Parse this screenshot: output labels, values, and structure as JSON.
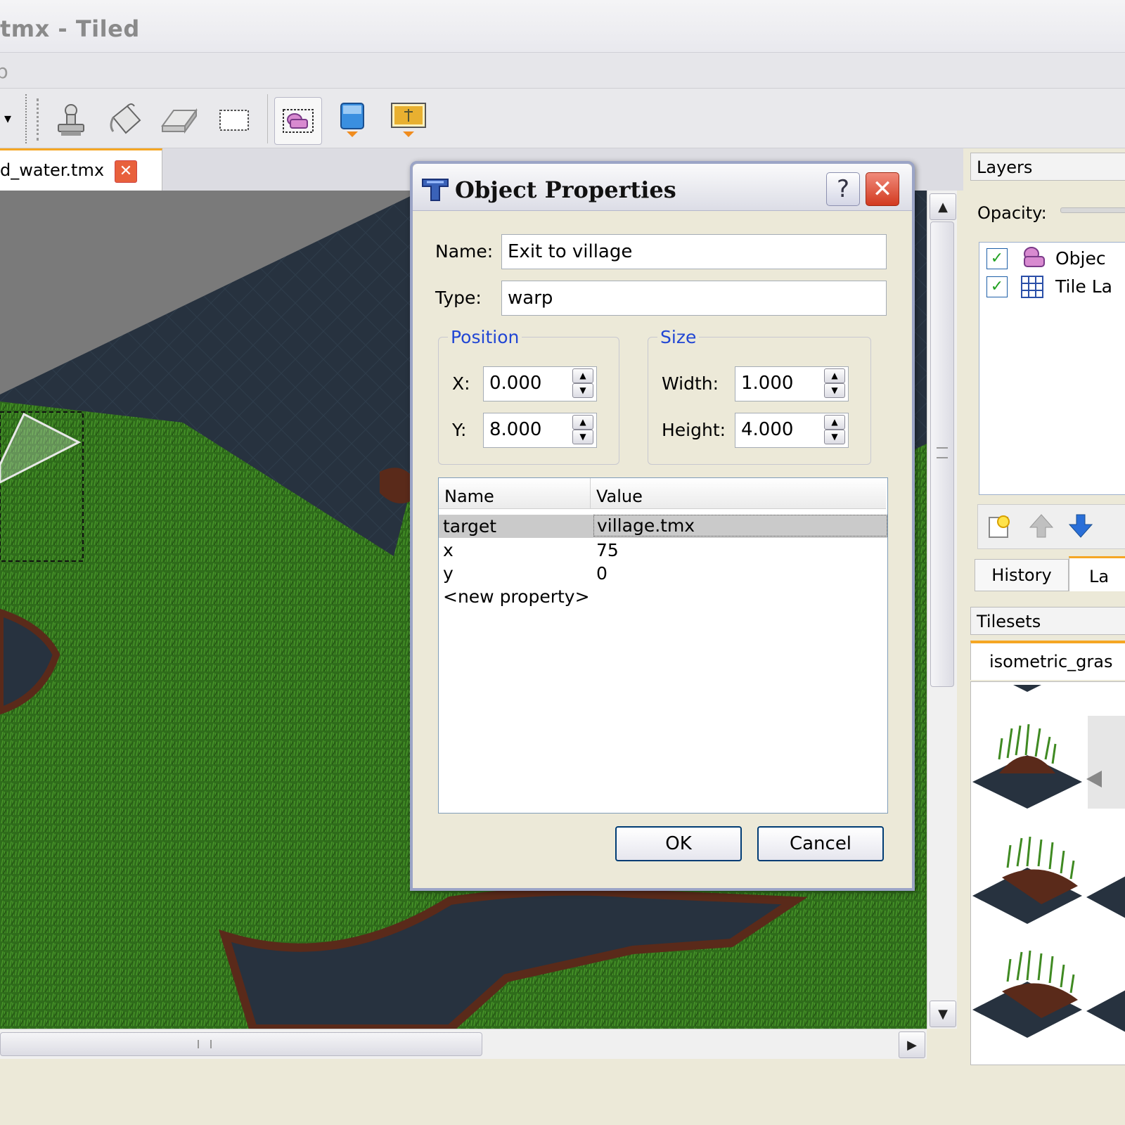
{
  "window": {
    "title": "tmx - Tiled"
  },
  "menubar": {
    "visible_fragment": "p"
  },
  "toolbar": {
    "tools": [
      {
        "icon": "stamp-brush-icon"
      },
      {
        "icon": "bucket-fill-icon"
      },
      {
        "icon": "eraser-icon"
      },
      {
        "icon": "rectangle-select-icon"
      },
      {
        "icon": "select-objects-icon",
        "active": true
      },
      {
        "icon": "insert-object-icon"
      },
      {
        "icon": "insert-image-icon"
      }
    ]
  },
  "tabs": [
    {
      "label": "d_water.tmx",
      "close_icon": "close-icon"
    }
  ],
  "dialog": {
    "title": "Object Properties",
    "help_label": "?",
    "name_label": "Name:",
    "name_value": "Exit to village",
    "type_label": "Type:",
    "type_value": "warp",
    "position": {
      "title": "Position",
      "x_label": "X:",
      "x_value": "0.000",
      "y_label": "Y:",
      "y_value": "8.000"
    },
    "size": {
      "title": "Size",
      "width_label": "Width:",
      "width_value": "1.000",
      "height_label": "Height:",
      "height_value": "4.000"
    },
    "table": {
      "headers": [
        "Name",
        "Value"
      ],
      "rows": [
        {
          "name": "target",
          "value": "village.tmx",
          "selected": true
        },
        {
          "name": "x",
          "value": "75"
        },
        {
          "name": "y",
          "value": "0"
        },
        {
          "name": "<new property>",
          "value": ""
        }
      ]
    },
    "ok_label": "OK",
    "cancel_label": "Cancel"
  },
  "layers_panel": {
    "title": "Layers",
    "opacity_label": "Opacity:",
    "layers": [
      {
        "label": "Objec",
        "checked": true,
        "icon": "object-layer-icon"
      },
      {
        "label": "Tile La",
        "checked": true,
        "icon": "tile-layer-icon"
      }
    ]
  },
  "dock_tabs": {
    "history": "History",
    "layers_partial": "La"
  },
  "tilesets_panel": {
    "title": "Tilesets",
    "tab_label": "isometric_gras"
  },
  "colors": {
    "accent_orange": "#f5a623",
    "dialog_border": "#9ba4c6",
    "group_title": "#2146d4",
    "grass": "#2e6b1a",
    "water": "#263442"
  }
}
